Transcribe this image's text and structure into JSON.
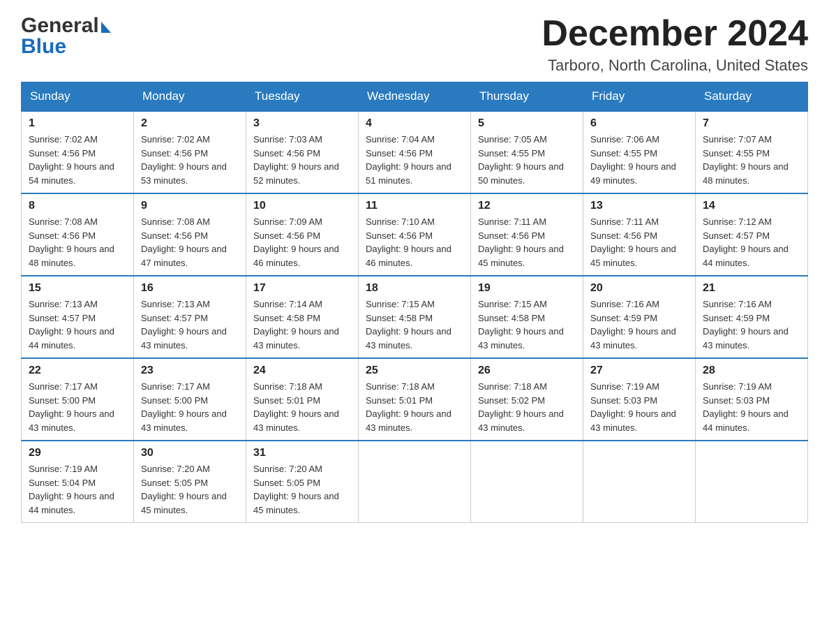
{
  "header": {
    "logo_general": "General",
    "logo_blue": "Blue",
    "month_title": "December 2024",
    "location": "Tarboro, North Carolina, United States"
  },
  "weekdays": [
    "Sunday",
    "Monday",
    "Tuesday",
    "Wednesday",
    "Thursday",
    "Friday",
    "Saturday"
  ],
  "weeks": [
    [
      {
        "day": "1",
        "sunrise": "7:02 AM",
        "sunset": "4:56 PM",
        "daylight": "9 hours and 54 minutes."
      },
      {
        "day": "2",
        "sunrise": "7:02 AM",
        "sunset": "4:56 PM",
        "daylight": "9 hours and 53 minutes."
      },
      {
        "day": "3",
        "sunrise": "7:03 AM",
        "sunset": "4:56 PM",
        "daylight": "9 hours and 52 minutes."
      },
      {
        "day": "4",
        "sunrise": "7:04 AM",
        "sunset": "4:56 PM",
        "daylight": "9 hours and 51 minutes."
      },
      {
        "day": "5",
        "sunrise": "7:05 AM",
        "sunset": "4:55 PM",
        "daylight": "9 hours and 50 minutes."
      },
      {
        "day": "6",
        "sunrise": "7:06 AM",
        "sunset": "4:55 PM",
        "daylight": "9 hours and 49 minutes."
      },
      {
        "day": "7",
        "sunrise": "7:07 AM",
        "sunset": "4:55 PM",
        "daylight": "9 hours and 48 minutes."
      }
    ],
    [
      {
        "day": "8",
        "sunrise": "7:08 AM",
        "sunset": "4:56 PM",
        "daylight": "9 hours and 48 minutes."
      },
      {
        "day": "9",
        "sunrise": "7:08 AM",
        "sunset": "4:56 PM",
        "daylight": "9 hours and 47 minutes."
      },
      {
        "day": "10",
        "sunrise": "7:09 AM",
        "sunset": "4:56 PM",
        "daylight": "9 hours and 46 minutes."
      },
      {
        "day": "11",
        "sunrise": "7:10 AM",
        "sunset": "4:56 PM",
        "daylight": "9 hours and 46 minutes."
      },
      {
        "day": "12",
        "sunrise": "7:11 AM",
        "sunset": "4:56 PM",
        "daylight": "9 hours and 45 minutes."
      },
      {
        "day": "13",
        "sunrise": "7:11 AM",
        "sunset": "4:56 PM",
        "daylight": "9 hours and 45 minutes."
      },
      {
        "day": "14",
        "sunrise": "7:12 AM",
        "sunset": "4:57 PM",
        "daylight": "9 hours and 44 minutes."
      }
    ],
    [
      {
        "day": "15",
        "sunrise": "7:13 AM",
        "sunset": "4:57 PM",
        "daylight": "9 hours and 44 minutes."
      },
      {
        "day": "16",
        "sunrise": "7:13 AM",
        "sunset": "4:57 PM",
        "daylight": "9 hours and 43 minutes."
      },
      {
        "day": "17",
        "sunrise": "7:14 AM",
        "sunset": "4:58 PM",
        "daylight": "9 hours and 43 minutes."
      },
      {
        "day": "18",
        "sunrise": "7:15 AM",
        "sunset": "4:58 PM",
        "daylight": "9 hours and 43 minutes."
      },
      {
        "day": "19",
        "sunrise": "7:15 AM",
        "sunset": "4:58 PM",
        "daylight": "9 hours and 43 minutes."
      },
      {
        "day": "20",
        "sunrise": "7:16 AM",
        "sunset": "4:59 PM",
        "daylight": "9 hours and 43 minutes."
      },
      {
        "day": "21",
        "sunrise": "7:16 AM",
        "sunset": "4:59 PM",
        "daylight": "9 hours and 43 minutes."
      }
    ],
    [
      {
        "day": "22",
        "sunrise": "7:17 AM",
        "sunset": "5:00 PM",
        "daylight": "9 hours and 43 minutes."
      },
      {
        "day": "23",
        "sunrise": "7:17 AM",
        "sunset": "5:00 PM",
        "daylight": "9 hours and 43 minutes."
      },
      {
        "day": "24",
        "sunrise": "7:18 AM",
        "sunset": "5:01 PM",
        "daylight": "9 hours and 43 minutes."
      },
      {
        "day": "25",
        "sunrise": "7:18 AM",
        "sunset": "5:01 PM",
        "daylight": "9 hours and 43 minutes."
      },
      {
        "day": "26",
        "sunrise": "7:18 AM",
        "sunset": "5:02 PM",
        "daylight": "9 hours and 43 minutes."
      },
      {
        "day": "27",
        "sunrise": "7:19 AM",
        "sunset": "5:03 PM",
        "daylight": "9 hours and 43 minutes."
      },
      {
        "day": "28",
        "sunrise": "7:19 AM",
        "sunset": "5:03 PM",
        "daylight": "9 hours and 44 minutes."
      }
    ],
    [
      {
        "day": "29",
        "sunrise": "7:19 AM",
        "sunset": "5:04 PM",
        "daylight": "9 hours and 44 minutes."
      },
      {
        "day": "30",
        "sunrise": "7:20 AM",
        "sunset": "5:05 PM",
        "daylight": "9 hours and 45 minutes."
      },
      {
        "day": "31",
        "sunrise": "7:20 AM",
        "sunset": "5:05 PM",
        "daylight": "9 hours and 45 minutes."
      },
      null,
      null,
      null,
      null
    ]
  ],
  "labels": {
    "sunrise": "Sunrise:",
    "sunset": "Sunset:",
    "daylight": "Daylight:"
  }
}
